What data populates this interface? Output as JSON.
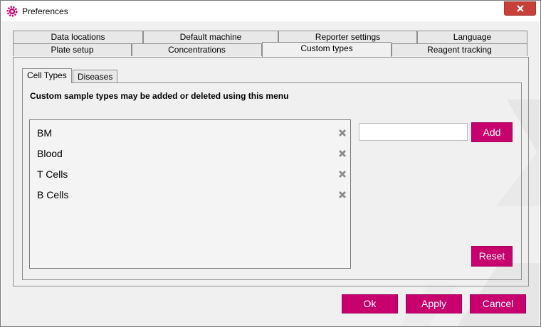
{
  "window": {
    "title": "Preferences",
    "app_icon": "gear-icon",
    "close_icon": "close-icon"
  },
  "tabs_row1": [
    {
      "label": "Data locations"
    },
    {
      "label": "Default machine"
    },
    {
      "label": "Reporter settings"
    },
    {
      "label": "Language"
    }
  ],
  "tabs_row2": [
    {
      "label": "Plate setup"
    },
    {
      "label": "Concentrations"
    },
    {
      "label": "Custom types",
      "active": true
    },
    {
      "label": "Reagent tracking"
    }
  ],
  "subtabs": [
    {
      "label": "Cell Types",
      "active": true
    },
    {
      "label": "Diseases"
    }
  ],
  "hint": "Custom sample types may be added or deleted using this menu",
  "cell_types": [
    "BM",
    "Blood",
    "T Cells",
    "B Cells"
  ],
  "delete_icon": "delete-x-icon",
  "new_type_input": {
    "value": "",
    "placeholder": ""
  },
  "buttons": {
    "add": "Add",
    "reset": "Reset",
    "ok": "Ok",
    "apply": "Apply",
    "cancel": "Cancel"
  },
  "colors": {
    "accent": "#c8006e",
    "close": "#c7403a",
    "background": "#f0f0f0"
  }
}
